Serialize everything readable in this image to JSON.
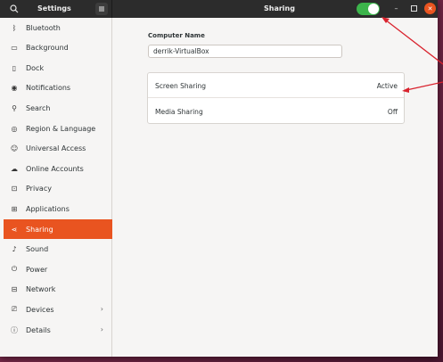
{
  "header": {
    "app_title": "Settings",
    "page_title": "Sharing",
    "sharing_toggle_on": true
  },
  "sidebar": {
    "items": [
      {
        "label": "Bluetooth",
        "icon": "bluetooth-icon"
      },
      {
        "label": "Background",
        "icon": "background-icon"
      },
      {
        "label": "Dock",
        "icon": "dock-icon"
      },
      {
        "label": "Notifications",
        "icon": "bell-icon"
      },
      {
        "label": "Search",
        "icon": "search-icon"
      },
      {
        "label": "Region & Language",
        "icon": "globe-icon"
      },
      {
        "label": "Universal Access",
        "icon": "accessibility-icon"
      },
      {
        "label": "Online Accounts",
        "icon": "cloud-icon"
      },
      {
        "label": "Privacy",
        "icon": "lock-icon"
      },
      {
        "label": "Applications",
        "icon": "grid-icon"
      },
      {
        "label": "Sharing",
        "icon": "share-icon",
        "active": true
      },
      {
        "label": "Sound",
        "icon": "music-note-icon"
      },
      {
        "label": "Power",
        "icon": "power-icon"
      },
      {
        "label": "Network",
        "icon": "network-icon"
      },
      {
        "label": "Devices",
        "icon": "devices-icon",
        "has_submenu": true
      },
      {
        "label": "Details",
        "icon": "info-icon",
        "has_submenu": true
      }
    ]
  },
  "main": {
    "computer_name_label": "Computer Name",
    "computer_name_value": "derrik-VirtualBox",
    "services": [
      {
        "label": "Screen Sharing",
        "status": "Active"
      },
      {
        "label": "Media Sharing",
        "status": "Off"
      }
    ]
  },
  "colors": {
    "accent": "#e95420",
    "toggle_on": "#3cb44b",
    "annotation_arrow": "#d9232e"
  }
}
